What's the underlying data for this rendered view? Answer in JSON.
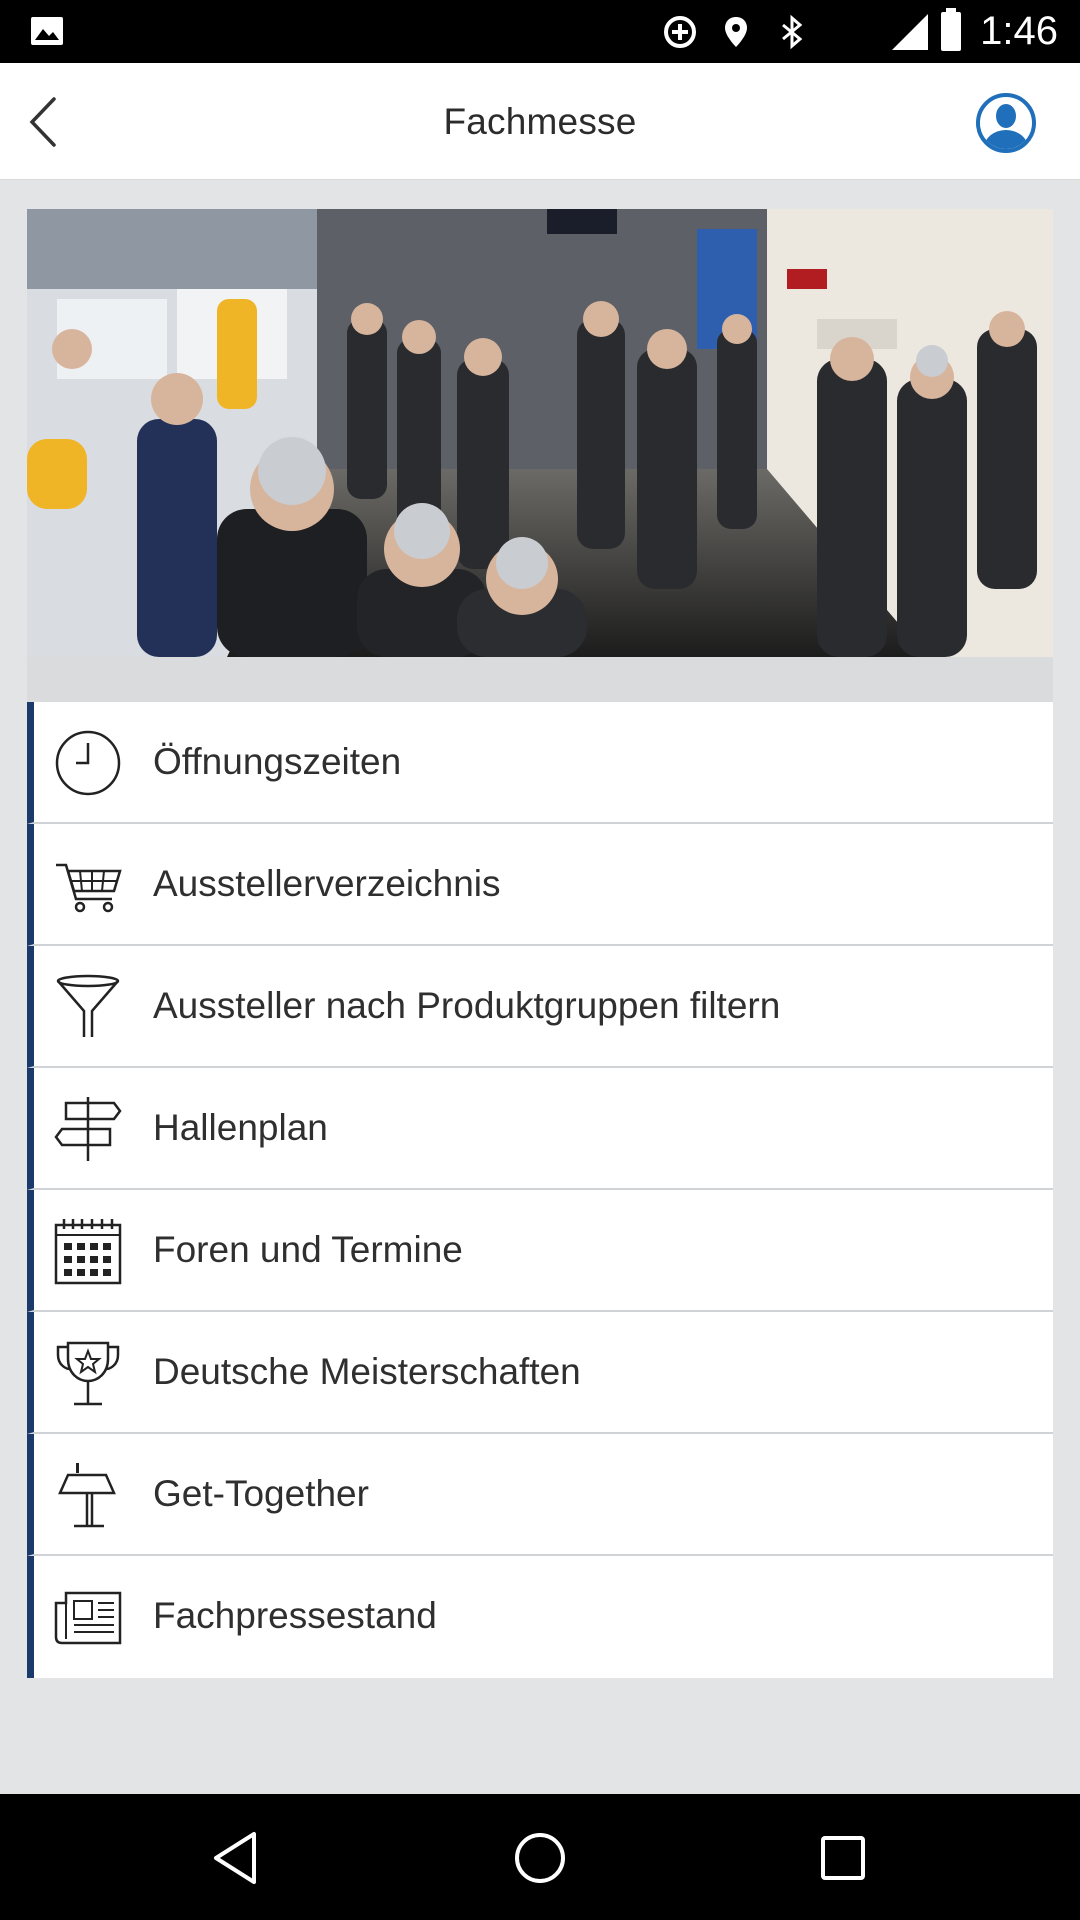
{
  "status_bar": {
    "time": "1:46",
    "icons": [
      "gallery-icon",
      "data-saver-icon",
      "location-icon",
      "bluetooth-icon"
    ]
  },
  "app_bar": {
    "title": "Fachmesse",
    "back_icon": "chevron-left-icon",
    "profile_icon": "user-profile-icon"
  },
  "colors": {
    "accent": "#1a3a6b",
    "profile_blue": "#1f6fba",
    "background": "#e2e4e5"
  },
  "menu": {
    "items": [
      {
        "label": "Öffnungszeiten",
        "icon": "clock-icon"
      },
      {
        "label": "Ausstellerverzeichnis",
        "icon": "cart-icon"
      },
      {
        "label": "Aussteller nach Produktgruppen filtern",
        "icon": "filter-funnel-icon"
      },
      {
        "label": "Hallenplan",
        "icon": "signpost-icon"
      },
      {
        "label": "Foren und Termine",
        "icon": "calendar-icon"
      },
      {
        "label": "Deutsche Meisterschaften",
        "icon": "trophy-icon"
      },
      {
        "label": "Get-Together",
        "icon": "standing-table-icon"
      },
      {
        "label": "Fachpressestand",
        "icon": "newspaper-icon"
      }
    ]
  },
  "nav_bar": {
    "back": "nav-back-icon",
    "home": "nav-home-icon",
    "recents": "nav-recents-icon"
  }
}
